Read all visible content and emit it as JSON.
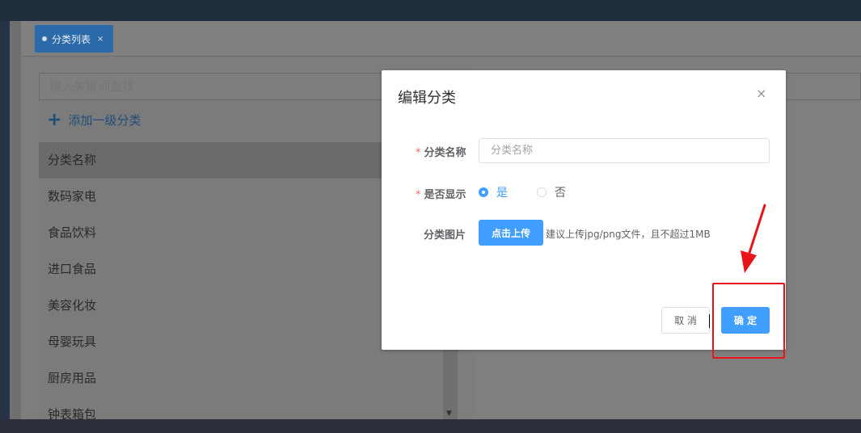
{
  "tabs": [
    {
      "label": "分类列表",
      "close": "×"
    }
  ],
  "left_panel": {
    "search_placeholder": "输入关键词查找",
    "add_button_label": "添加一级分类",
    "list_header": "分类名称",
    "items": [
      "数码家电",
      "食品饮料",
      "进口食品",
      "美容化妆",
      "母婴玩具",
      "厨房用品",
      "钟表箱包"
    ]
  },
  "dialog": {
    "title": "编辑分类",
    "close_icon": "×",
    "fields": {
      "name": {
        "label": "分类名称",
        "placeholder": "分类名称",
        "required_mark": "*"
      },
      "visible": {
        "label": "是否显示",
        "required_mark": "*",
        "options": [
          "是",
          "否"
        ],
        "selected": "是"
      },
      "image": {
        "label": "分类图片",
        "button": "点击上传",
        "hint": "建议上传jpg/png文件，且不超过1MB"
      }
    },
    "cancel_label": "取 消",
    "confirm_label": "确 定"
  },
  "colors": {
    "primary": "#409eff",
    "annotation": "#e8141b",
    "tab_active": "#2a6aa8"
  }
}
